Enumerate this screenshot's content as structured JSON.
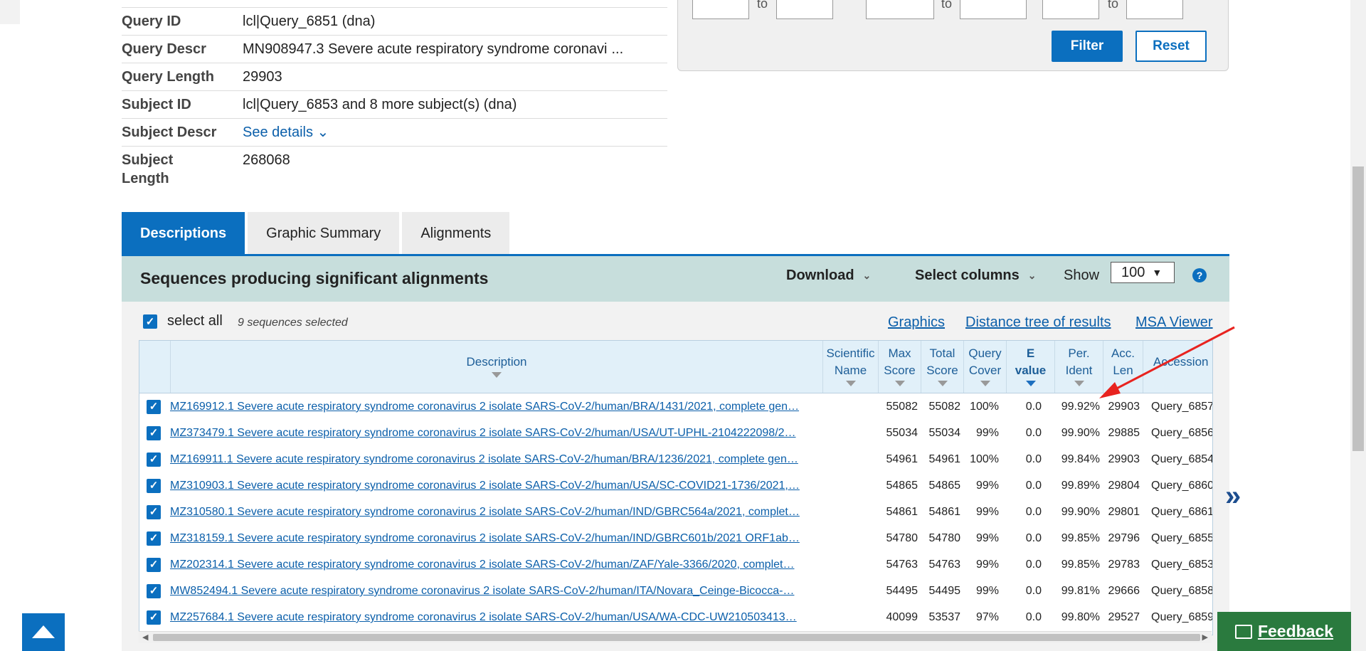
{
  "query_info": {
    "rows": [
      {
        "key": "Query ID",
        "value": "lcl|Query_6851 (dna)"
      },
      {
        "key": "Query Descr",
        "value": "MN908947.3 Severe acute respiratory syndrome coronavi",
        "more": "..."
      },
      {
        "key": "Query Length",
        "value": "29903"
      },
      {
        "key": "Subject ID",
        "value": "lcl|Query_6853 and 8 more subject(s) (dna)"
      },
      {
        "key": "Subject Descr",
        "value": "See details ⌄"
      },
      {
        "key": "Subject Length",
        "value": "268068"
      }
    ]
  },
  "filter": {
    "to_label": "to",
    "filter_label": "Filter",
    "reset_label": "Reset"
  },
  "tabs": [
    {
      "label": "Descriptions",
      "active": true
    },
    {
      "label": "Graphic Summary",
      "active": false
    },
    {
      "label": "Alignments",
      "active": false
    }
  ],
  "results_header": {
    "title": "Sequences producing significant alignments",
    "download_label": "Download",
    "select_columns_label": "Select columns",
    "show_label": "Show",
    "show_value": "100",
    "help_icon": "?"
  },
  "selection": {
    "select_all_label": "select all",
    "count_text": "9 sequences selected"
  },
  "links": {
    "graphics": "Graphics",
    "distance_tree": "Distance tree of results",
    "msa_viewer": "MSA Viewer"
  },
  "columns": {
    "description": "Description",
    "scientific_name": [
      "Scientific",
      "Name"
    ],
    "max_score": [
      "Max",
      "Score"
    ],
    "total_score": [
      "Total",
      "Score"
    ],
    "query_cover": [
      "Query",
      "Cover"
    ],
    "e_value": [
      "E",
      "value"
    ],
    "per_ident": [
      "Per.",
      "Ident"
    ],
    "acc_len": [
      "Acc.",
      "Len"
    ],
    "accession": "Accession"
  },
  "rows": [
    {
      "desc": "MZ169912.1 Severe acute respiratory syndrome coronavirus 2 isolate SARS-CoV-2/human/BRA/1431/2021, complete gen…",
      "max": "55082",
      "total": "55082",
      "cover": "100%",
      "e": "0.0",
      "ident": "99.92%",
      "len": "29903",
      "acc": "Query_6857"
    },
    {
      "desc": "MZ373479.1 Severe acute respiratory syndrome coronavirus 2 isolate SARS-CoV-2/human/USA/UT-UPHL-2104222098/2…",
      "max": "55034",
      "total": "55034",
      "cover": "99%",
      "e": "0.0",
      "ident": "99.90%",
      "len": "29885",
      "acc": "Query_6856"
    },
    {
      "desc": "MZ169911.1 Severe acute respiratory syndrome coronavirus 2 isolate SARS-CoV-2/human/BRA/1236/2021, complete gen…",
      "max": "54961",
      "total": "54961",
      "cover": "100%",
      "e": "0.0",
      "ident": "99.84%",
      "len": "29903",
      "acc": "Query_6854"
    },
    {
      "desc": "MZ310903.1 Severe acute respiratory syndrome coronavirus 2 isolate SARS-CoV-2/human/USA/SC-COVID21-1736/2021,…",
      "max": "54865",
      "total": "54865",
      "cover": "99%",
      "e": "0.0",
      "ident": "99.89%",
      "len": "29804",
      "acc": "Query_6860"
    },
    {
      "desc": "MZ310580.1 Severe acute respiratory syndrome coronavirus 2 isolate SARS-CoV-2/human/IND/GBRC564a/2021, complet…",
      "max": "54861",
      "total": "54861",
      "cover": "99%",
      "e": "0.0",
      "ident": "99.90%",
      "len": "29801",
      "acc": "Query_6861"
    },
    {
      "desc": "MZ318159.1 Severe acute respiratory syndrome coronavirus 2 isolate SARS-CoV-2/human/IND/GBRC601b/2021 ORF1ab…",
      "max": "54780",
      "total": "54780",
      "cover": "99%",
      "e": "0.0",
      "ident": "99.85%",
      "len": "29796",
      "acc": "Query_6855"
    },
    {
      "desc": "MZ202314.1 Severe acute respiratory syndrome coronavirus 2 isolate SARS-CoV-2/human/ZAF/Yale-3366/2020, complet…",
      "max": "54763",
      "total": "54763",
      "cover": "99%",
      "e": "0.0",
      "ident": "99.85%",
      "len": "29783",
      "acc": "Query_6853"
    },
    {
      "desc": "MW852494.1 Severe acute respiratory syndrome coronavirus 2 isolate SARS-CoV-2/human/ITA/Novara_Ceinge-Bicocca-…",
      "max": "54495",
      "total": "54495",
      "cover": "99%",
      "e": "0.0",
      "ident": "99.81%",
      "len": "29666",
      "acc": "Query_6858"
    },
    {
      "desc": "MZ257684.1 Severe acute respiratory syndrome coronavirus 2 isolate SARS-CoV-2/human/USA/WA-CDC-UW210503413…",
      "max": "40099",
      "total": "53537",
      "cover": "97%",
      "e": "0.0",
      "ident": "99.80%",
      "len": "29527",
      "acc": "Query_6859"
    }
  ],
  "feedback_label": "Feedback",
  "next_icon": "»",
  "colors": {
    "primary": "#0b6fbf",
    "band": "#c7dedc",
    "feedback": "#2a7a3e",
    "annotation": "#e8231f"
  }
}
